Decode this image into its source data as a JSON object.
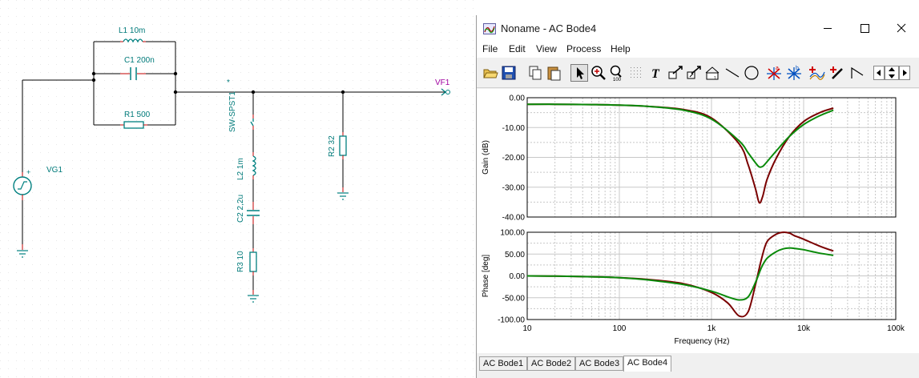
{
  "schematic": {
    "components": {
      "l1": "L1 10m",
      "c1": "C1 200n",
      "r1": "R1 500",
      "vg1": "VG1",
      "switch": "SW-SPST1",
      "switch_marker": "*",
      "l2": "L2 1m",
      "c2": "C2 2,2u",
      "r3": "R3 10",
      "r2": "R2 32",
      "vf1": "VF1"
    },
    "colors": {
      "wire": "#000000",
      "component": "#008080",
      "pin": "#c00000",
      "probe": "#a000a0"
    }
  },
  "window": {
    "title": "Noname - AC Bode4",
    "menu": [
      "File",
      "Edit",
      "View",
      "Process",
      "Help"
    ],
    "toolbar_icons": [
      "open-folder-icon",
      "save-icon",
      "copy-icon",
      "paste-icon",
      "pointer-icon",
      "zoom-in-icon",
      "zoom-100-icon",
      "grid-icon",
      "text-icon",
      "arrow-label-icon",
      "arrow-label2-icon",
      "arrow-label3-icon",
      "line-icon",
      "circle-icon",
      "cursor-a-icon",
      "cursor-b-icon",
      "trace-add-icon",
      "pen-icon",
      "flag-icon",
      "scroll-left-icon",
      "scroll-updown-icon",
      "scroll-right-icon"
    ],
    "tabs": [
      "AC Bode1",
      "AC Bode2",
      "AC Bode3",
      "AC Bode4"
    ],
    "active_tab": "AC Bode4",
    "colors": {
      "series1": "#7a0000",
      "series2": "#0a8a0a",
      "grid": "#c8c8c8",
      "plot_bg": "#ffffff"
    }
  },
  "chart_data": [
    {
      "type": "line",
      "title": "",
      "xlabel": "",
      "ylabel": "Gain (dB)",
      "xscale": "log",
      "xlim": [
        10,
        100000
      ],
      "ylim": [
        -40,
        0
      ],
      "yticks": [
        "0.00",
        "-10.00",
        "-20.00",
        "-30.00",
        "-40.00"
      ],
      "grid": true,
      "series": [
        {
          "color": "#7a0000",
          "x": [
            10,
            20,
            50,
            100,
            200,
            500,
            1000,
            2000,
            2500,
            3000,
            3300,
            3600,
            4000,
            5000,
            7000,
            10000,
            15000,
            21000
          ],
          "y": [
            -2.2,
            -2.2,
            -2.3,
            -2.5,
            -2.9,
            -4.0,
            -6.8,
            -15.5,
            -22.5,
            -30.5,
            -35.2,
            -33.0,
            -27.5,
            -20.5,
            -13.0,
            -8.0,
            -5.0,
            -3.5
          ]
        },
        {
          "color": "#0a8a0a",
          "x": [
            10,
            20,
            50,
            100,
            200,
            500,
            1000,
            2000,
            2500,
            3000,
            3300,
            3600,
            4000,
            5000,
            7000,
            10000,
            15000,
            21000
          ],
          "y": [
            -2.2,
            -2.2,
            -2.3,
            -2.5,
            -2.9,
            -4.2,
            -7.2,
            -14.5,
            -18.5,
            -21.8,
            -23.2,
            -23.0,
            -21.5,
            -18.0,
            -13.0,
            -9.0,
            -6.0,
            -4.2
          ]
        }
      ]
    },
    {
      "type": "line",
      "title": "",
      "xlabel": "Frequency (Hz)",
      "ylabel": "Phase [deg]",
      "xscale": "log",
      "xlim": [
        10,
        100000
      ],
      "ylim": [
        -100,
        100
      ],
      "yticks": [
        "100.00",
        "50.00",
        "0.00",
        "-50.00",
        "-100.00"
      ],
      "xticks": [
        "10",
        "100",
        "1k",
        "10k",
        "100k"
      ],
      "grid": true,
      "series": [
        {
          "color": "#7a0000",
          "x": [
            10,
            20,
            50,
            100,
            200,
            500,
            1000,
            1500,
            2000,
            2500,
            3000,
            3500,
            4000,
            5000,
            6000,
            7000,
            8000,
            10000,
            15000,
            21000
          ],
          "y": [
            0,
            -0.5,
            -2,
            -4,
            -8,
            -18,
            -38,
            -62,
            -92,
            -82,
            -20,
            40,
            78,
            95,
            100,
            98,
            92,
            84,
            68,
            57
          ]
        },
        {
          "color": "#0a8a0a",
          "x": [
            10,
            20,
            50,
            100,
            200,
            500,
            1000,
            1500,
            2000,
            2500,
            3000,
            3500,
            4000,
            5000,
            6000,
            7000,
            8000,
            10000,
            15000,
            21000
          ],
          "y": [
            0,
            -0.5,
            -2,
            -4,
            -9,
            -20,
            -35,
            -48,
            -55,
            -48,
            -15,
            20,
            40,
            55,
            62,
            64,
            63,
            60,
            52,
            47
          ]
        }
      ]
    }
  ]
}
